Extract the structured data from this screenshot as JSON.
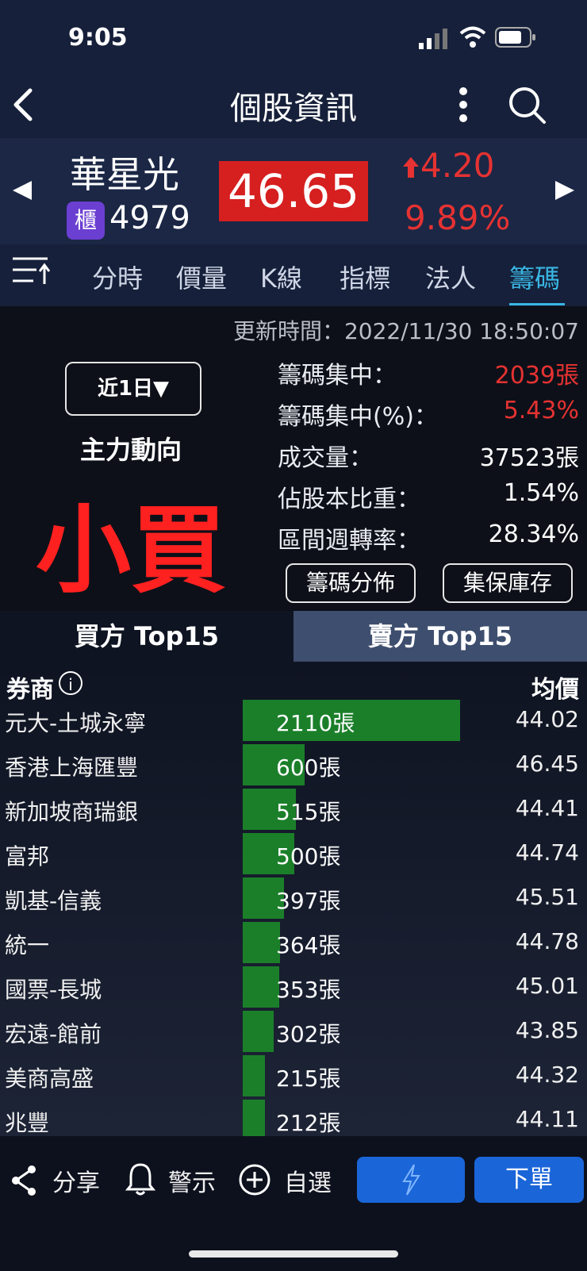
{
  "status": {
    "time": "9:05"
  },
  "nav": {
    "title": "個股資訊",
    "back_icon": "chevron-left-icon",
    "more_icon": "kebab-icon",
    "search_icon": "search-icon"
  },
  "stock": {
    "name": "華星光",
    "board": "櫃",
    "code": "4979",
    "price": "46.65",
    "change": "4.20",
    "change_pct": "9.89%",
    "accent_up": "#e63232"
  },
  "tabs": {
    "items": [
      "分時",
      "價量",
      "K線",
      "指標",
      "法人",
      "籌碼"
    ],
    "active": "籌碼",
    "active_color": "#39b6e3"
  },
  "updated": "更新時間：2022/11/30 18:50:07",
  "summary": {
    "period": "近1日▼",
    "main_dir_label": "主力動向",
    "main_signal": "小買",
    "metrics": [
      {
        "label": "籌碼集中：",
        "value": "2039張",
        "color": "#e63232"
      },
      {
        "label": "籌碼集中(%)：",
        "value": "5.43%",
        "color": "#e63232"
      },
      {
        "label": "成交量：",
        "value": "37523張",
        "color": "#ffffff"
      },
      {
        "label": "佔股本比重：",
        "value": "1.54%",
        "color": "#ffffff"
      },
      {
        "label": "區間週轉率：",
        "value": "28.34%",
        "color": "#ffffff"
      }
    ],
    "btn_distribution": "籌碼分佈",
    "btn_custody": "集保庫存"
  },
  "bs_tabs": {
    "buy": "買方 Top15",
    "sell": "賣方 Top15"
  },
  "table": {
    "col_broker": "券商",
    "col_avg": "均價",
    "rows": [
      {
        "broker": "元大-土城永寧",
        "vol": "2110張",
        "avg": "44.02",
        "lots": 2110
      },
      {
        "broker": "香港上海匯豐",
        "vol": "600張",
        "avg": "46.45",
        "lots": 600
      },
      {
        "broker": "新加坡商瑞銀",
        "vol": "515張",
        "avg": "44.41",
        "lots": 515
      },
      {
        "broker": "富邦",
        "vol": "500張",
        "avg": "44.74",
        "lots": 500
      },
      {
        "broker": "凱基-信義",
        "vol": "397張",
        "avg": "45.51",
        "lots": 397
      },
      {
        "broker": "統一",
        "vol": "364張",
        "avg": "44.78",
        "lots": 364
      },
      {
        "broker": "國票-長城",
        "vol": "353張",
        "avg": "45.01",
        "lots": 353
      },
      {
        "broker": "宏遠-館前",
        "vol": "302張",
        "avg": "43.85",
        "lots": 302
      },
      {
        "broker": "美商高盛",
        "vol": "215張",
        "avg": "44.32",
        "lots": 215
      },
      {
        "broker": "兆豐",
        "vol": "212張",
        "avg": "44.11",
        "lots": 212
      }
    ]
  },
  "bottom": {
    "share": "分享",
    "alert": "警示",
    "watch": "自選",
    "order": "下單"
  }
}
